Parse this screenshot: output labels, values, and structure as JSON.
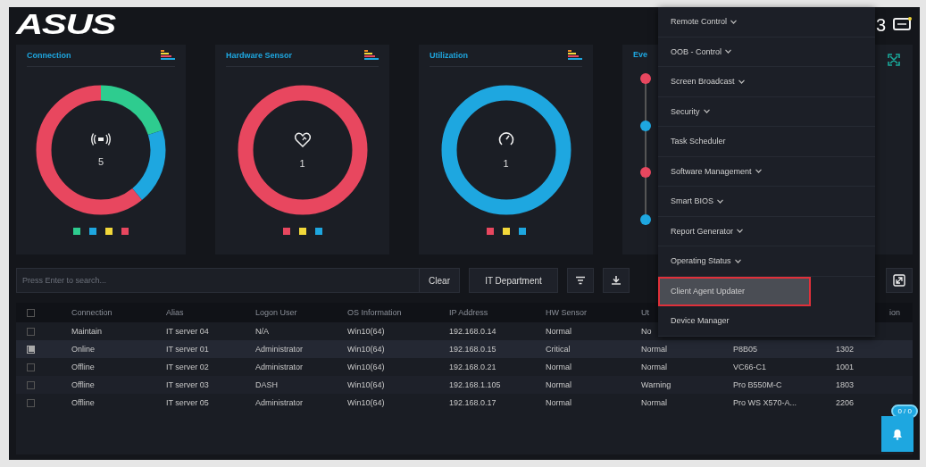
{
  "header": {
    "logo": "ASUS",
    "user_badge": "3"
  },
  "cards": [
    {
      "title": "Connection",
      "kind": "wireless",
      "count": "5",
      "legend": [
        {
          "color": "#2ecc8f"
        },
        {
          "color": "#1ea7e0"
        },
        {
          "color": "#f2d83a"
        },
        {
          "color": "#e8475f"
        }
      ]
    },
    {
      "title": "Hardware Sensor",
      "kind": "heart",
      "count": "1",
      "legend": [
        {
          "color": "#e8475f"
        },
        {
          "color": "#f2d83a"
        },
        {
          "color": "#1ea7e0"
        }
      ]
    },
    {
      "title": "Utilization",
      "kind": "gauge",
      "count": "1",
      "legend": [
        {
          "color": "#e8475f"
        },
        {
          "color": "#f2d83a"
        },
        {
          "color": "#1ea7e0"
        }
      ]
    }
  ],
  "events_card": {
    "title": "Eve",
    "dots": [
      {
        "color": "#e8475f"
      },
      {
        "color": "#1ea7e0"
      },
      {
        "color": "#e8475f"
      },
      {
        "color": "#1ea7e0"
      }
    ]
  },
  "toolbar": {
    "search": {
      "placeholder": "Press Enter to search..."
    },
    "clear": "Clear",
    "group": "IT Department"
  },
  "table": {
    "select_all_checked": false,
    "columns": [
      "Connection",
      "Alias",
      "Logon User",
      "OS Information",
      "IP Address",
      "HW Sensor",
      "Ut"
    ],
    "last_column": "ion",
    "rows": [
      {
        "checked": false,
        "cells": [
          "Maintain",
          "IT server 04",
          "N/A",
          "Win10(64)",
          "192.168.0.14",
          "Normal",
          "No"
        ]
      },
      {
        "checked": true,
        "cells": [
          "Online",
          "IT server 01",
          "Administrator",
          "Win10(64)",
          "192.168.0.15",
          "Critical",
          "Normal",
          "P8B05",
          "1302"
        ]
      },
      {
        "checked": false,
        "cells": [
          "Offline",
          "IT server 02",
          "Administrator",
          "Win10(64)",
          "192.168.0.21",
          "Normal",
          "Normal",
          "VC66-C1",
          "1001"
        ]
      },
      {
        "checked": false,
        "cells": [
          "Offline",
          "IT server 03",
          "DASH",
          "Win10(64)",
          "192.168.1.105",
          "Normal",
          "Warning",
          "Pro B550M-C",
          "1803"
        ]
      },
      {
        "checked": false,
        "cells": [
          "Offline",
          "IT server 05",
          "Administrator",
          "Win10(64)",
          "192.168.0.17",
          "Normal",
          "Normal",
          "Pro WS X570-A...",
          "2206"
        ]
      }
    ]
  },
  "menu": [
    {
      "label": "Remote Control",
      "submenu": true,
      "selected": false
    },
    {
      "label": "OOB - Control",
      "submenu": true,
      "selected": false
    },
    {
      "label": "Screen Broadcast",
      "submenu": true,
      "selected": false
    },
    {
      "label": "Security",
      "submenu": true,
      "selected": false
    },
    {
      "label": "Task Scheduler",
      "submenu": false,
      "selected": false
    },
    {
      "label": "Software Management",
      "submenu": true,
      "selected": false
    },
    {
      "label": "Smart BIOS",
      "submenu": true,
      "selected": false
    },
    {
      "label": "Report Generator",
      "submenu": true,
      "selected": false
    },
    {
      "label": "Operating Status",
      "submenu": true,
      "selected": false
    },
    {
      "label": "Client Agent Updater",
      "submenu": false,
      "selected": true
    },
    {
      "label": "Device Manager",
      "submenu": false,
      "selected": false
    }
  ],
  "notifications": {
    "badge": "0 / 0"
  }
}
